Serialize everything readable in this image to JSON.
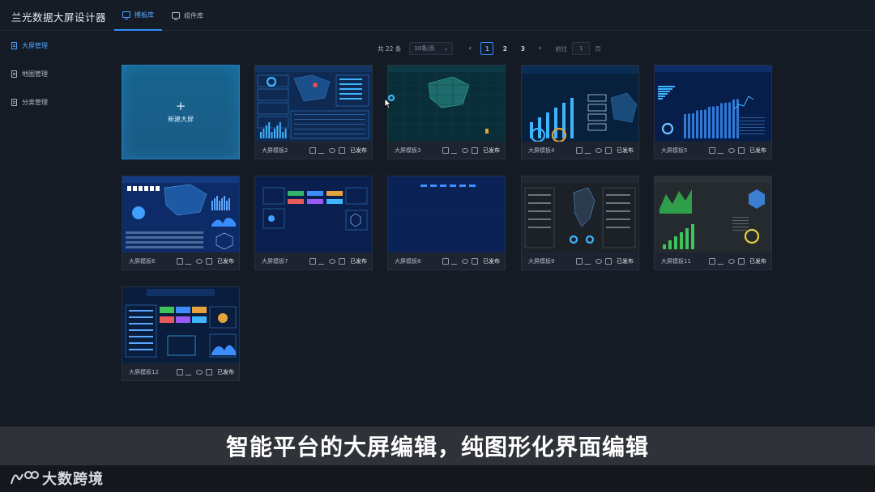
{
  "app": {
    "title": "兰光数据大屏设计器"
  },
  "tabs": [
    {
      "label": "模板库",
      "active": true
    },
    {
      "label": "组件库",
      "active": false
    }
  ],
  "sidebar": {
    "items": [
      {
        "label": "大屏管理",
        "active": true
      },
      {
        "label": "地图管理",
        "active": false
      },
      {
        "label": "分类管理",
        "active": false
      }
    ]
  },
  "pagination": {
    "total": "共 22 条",
    "page_size": "10条/页",
    "pages": [
      "1",
      "2",
      "3"
    ],
    "current": "1",
    "goto_label": "前往",
    "goto_value": "1",
    "goto_unit": "页"
  },
  "new_screen": {
    "label": "新建大屏",
    "plus": "+"
  },
  "templates": [
    {
      "name": "大屏模板2",
      "status": "已发布",
      "theme": "dashboard-blue"
    },
    {
      "name": "大屏模板3",
      "status": "已发布",
      "theme": "map-teal"
    },
    {
      "name": "大屏模板4",
      "status": "已发布",
      "theme": "city-night"
    },
    {
      "name": "大屏模板5",
      "status": "已发布",
      "theme": "bars-blue"
    },
    {
      "name": "大屏模板6",
      "status": "已发布",
      "theme": "china-map"
    },
    {
      "name": "大屏模板7",
      "status": "已发布",
      "theme": "navy-widgets"
    },
    {
      "name": "大屏模板8",
      "status": "已发布",
      "theme": "navy-empty"
    },
    {
      "name": "大屏模板9",
      "status": "已发布",
      "theme": "dark-map"
    },
    {
      "name": "大屏模板11",
      "status": "已发布",
      "theme": "green-charts"
    },
    {
      "name": "大屏模板12",
      "status": "已发布",
      "theme": "control-panel"
    }
  ],
  "caption": "智能平台的大屏编辑，纯图形化界面编辑",
  "watermark": {
    "text": "大数跨境"
  },
  "colors": {
    "accent": "#2f8cff",
    "background": "#151b25",
    "card": "#1d2430",
    "new_card": "#17648e"
  }
}
